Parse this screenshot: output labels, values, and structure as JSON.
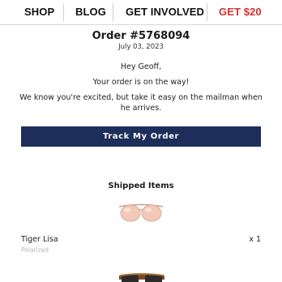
{
  "nav": {
    "shop": "SHOP",
    "blog": "BLOG",
    "get_involved": "GET INVOLVED",
    "promo": "GET $20"
  },
  "order": {
    "title": "Order #5768094",
    "date": "July 03, 2023"
  },
  "message": {
    "greeting": "Hey Geoff,",
    "status": "Your order is on the way!",
    "note": "We know you're excited, but take it easy on the mailman when he arrives."
  },
  "track_button": "Track My Order",
  "shipped": {
    "title": "Shipped Items",
    "items": [
      {
        "name": "Tiger Lisa",
        "variant": "Polarized",
        "quantity": "x 1",
        "image": "rose-tinted-sunglasses"
      },
      {
        "image": "tortoise-brown-sunglasses"
      }
    ]
  },
  "colors": {
    "accent_navy": "#1d2e5b",
    "promo_red": "#d32f2f",
    "lens_peach": "#f2c9b8",
    "frame_brown": "#7a4a22"
  }
}
